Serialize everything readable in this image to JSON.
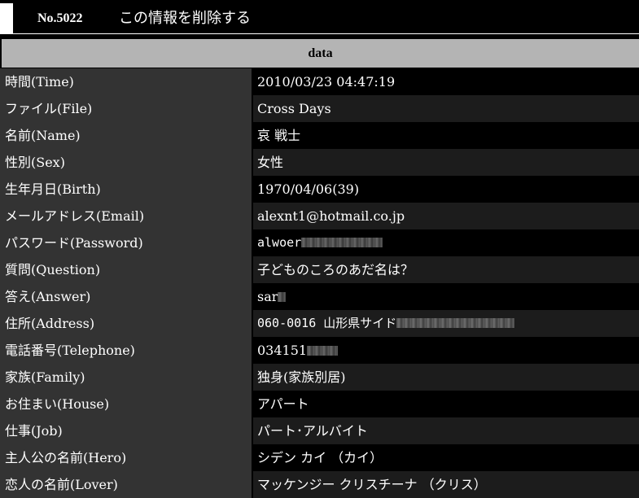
{
  "header": {
    "number": "No.5022",
    "delete_link": "この情報を削除する"
  },
  "table": {
    "caption": "data",
    "rows": [
      {
        "label": "時間(Time)",
        "value": "2010/03/23 04:47:19"
      },
      {
        "label": "ファイル(File)",
        "value": "Cross Days"
      },
      {
        "label": "名前(Name)",
        "value": "哀 戦士"
      },
      {
        "label": "性別(Sex)",
        "value": "女性"
      },
      {
        "label": "生年月日(Birth)",
        "value": "1970/04/06(39)"
      },
      {
        "label": "メールアドレス(Email)",
        "value": "alexnt1@hotmail.co.jp"
      },
      {
        "label": "パスワード(Password)",
        "value": "alwoer"
      },
      {
        "label": "質問(Question)",
        "value": "子どものころのあだ名は？"
      },
      {
        "label": "答え(Answer)",
        "value": "sar"
      },
      {
        "label": "住所(Address)",
        "value": "060-0016 山形県サイド"
      },
      {
        "label": "電話番号(Telephone)",
        "value": "034151"
      },
      {
        "label": "家族(Family)",
        "value": "独身(家族別居)"
      },
      {
        "label": "お住まい(House)",
        "value": "アパート"
      },
      {
        "label": "仕事(Job)",
        "value": "パート･アルバイト"
      },
      {
        "label": "主人公の名前(Hero)",
        "value": "シデン カイ （カイ）"
      },
      {
        "label": "恋人の名前(Lover)",
        "value": "マッケンジー クリスチーナ （クリス）"
      }
    ]
  },
  "colors": {
    "background": "#000000",
    "label_bg": "#333333",
    "value_bg_alt": "#1c1c1c",
    "caption_bg": "#b4b4b4",
    "text": "#ffffff"
  }
}
